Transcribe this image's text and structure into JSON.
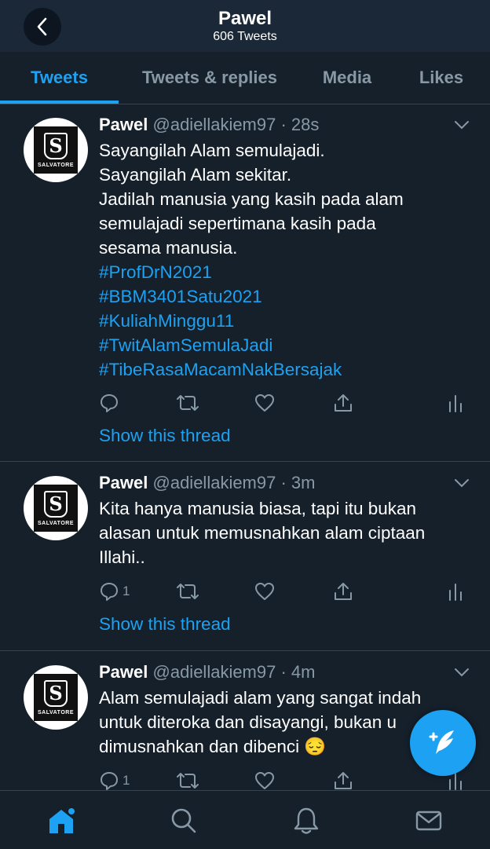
{
  "header": {
    "title": "Pawel",
    "subtitle": "606 Tweets"
  },
  "tabs": [
    {
      "label": "Tweets",
      "active": true
    },
    {
      "label": "Tweets & replies"
    },
    {
      "label": "Media"
    },
    {
      "label": "Likes"
    }
  ],
  "avatar_text": "SALVATORE",
  "tweets": [
    {
      "name": "Pawel",
      "handle": "@adiellakiem97",
      "time": "28s",
      "lines": [
        "Sayangilah Alam semulajadi.",
        "Sayangilah Alam sekitar.",
        "Jadilah manusia yang kasih pada alam",
        "semulajadi sepertimana kasih pada",
        "sesama manusia."
      ],
      "hashtags": [
        "#ProfDrN2021",
        "#BBM3401Satu2021",
        "#KuliahMinggu11",
        "#TwitAlamSemulaJadi",
        "#TibeRasaMacamNakBersajak"
      ],
      "reply_count": "",
      "thread_link": "Show this thread"
    },
    {
      "name": "Pawel",
      "handle": "@adiellakiem97",
      "time": "3m",
      "lines": [
        "Kita hanya manusia biasa, tapi itu bukan",
        "alasan untuk memusnahkan alam ciptaan",
        "Illahi.."
      ],
      "reply_count": "1",
      "thread_link": "Show this thread"
    },
    {
      "name": "Pawel",
      "handle": "@adiellakiem97",
      "time": "4m",
      "lines": [
        "Alam semulajadi alam yang sangat indah",
        "untuk diteroka dan disayangi, bukan u",
        "dimusnahkan dan dibenci 😔"
      ],
      "reply_count": "1"
    }
  ],
  "colors": {
    "background": "#15202b",
    "accent": "#1da1f2",
    "muted": "#8899a6",
    "divider": "#38444d"
  }
}
